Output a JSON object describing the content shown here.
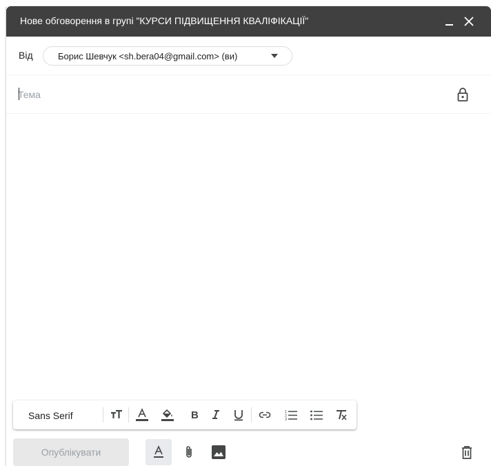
{
  "window": {
    "title": "Нове обговорення в групі \"КУРСИ ПІДВИЩЕННЯ КВАЛІФІКАЦІЇ\"",
    "minimize_icon": "minimize-icon",
    "close_icon": "close-icon"
  },
  "from": {
    "label": "Від",
    "value": "Борис Шевчук <sh.bera04@gmail.com> (ви)"
  },
  "subject": {
    "value": "",
    "placeholder": "Тема"
  },
  "body": {
    "value": ""
  },
  "format_bar": {
    "font": "Sans Serif",
    "tools": [
      "text-size-icon",
      "text-color-icon",
      "highlight-color-icon",
      "bold-icon",
      "italic-icon",
      "underline-icon",
      "link-icon",
      "numbered-list-icon",
      "bulleted-list-icon",
      "clear-formatting-icon"
    ]
  },
  "actions": {
    "publish_label": "Опублікувати",
    "icons": [
      "formatting-options-icon",
      "attach-icon",
      "insert-photo-icon",
      "delete-icon"
    ]
  },
  "colors": {
    "titlebar": "#404040",
    "publish_disabled_bg": "#e8e8e8",
    "icon": "#444746",
    "underline_bar": "#444746"
  }
}
